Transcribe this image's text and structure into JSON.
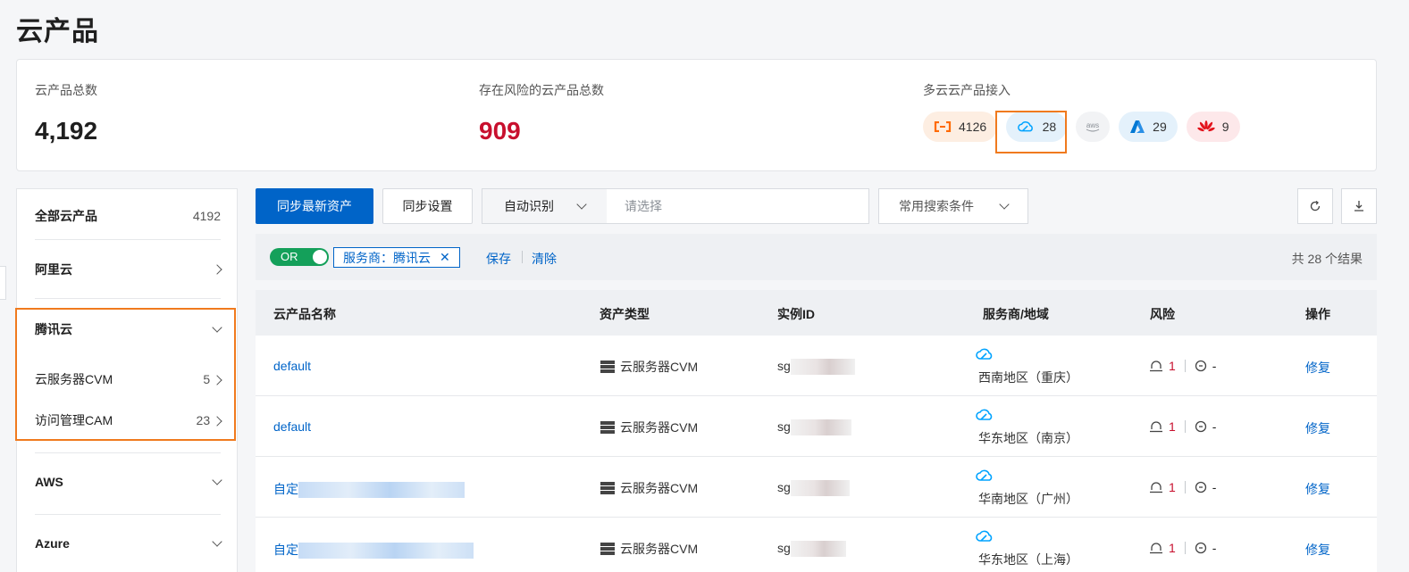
{
  "page_title": "云产品",
  "summary": {
    "total_label": "云产品总数",
    "total_value": "4,192",
    "risk_label": "存在风险的云产品总数",
    "risk_value": "909",
    "multicloud_label": "多云云产品接入",
    "providers": [
      {
        "icon": "aliyun-icon",
        "count": "4126",
        "color": "#ff6a00"
      },
      {
        "icon": "tencent-cloud-icon",
        "count": "28",
        "color": "#00a3ff"
      },
      {
        "icon": "aws-icon",
        "count": "",
        "label": "aws",
        "color": "#8a8f96"
      },
      {
        "icon": "azure-icon",
        "count": "29",
        "color": "#0078d4"
      },
      {
        "icon": "huawei-icon",
        "count": "9",
        "color": "#e3131c"
      }
    ]
  },
  "sidebar": {
    "all": {
      "label": "全部云产品",
      "count": "4192"
    },
    "groups": [
      {
        "label": "阿里云"
      },
      {
        "label": "腾讯云",
        "children": [
          {
            "label": "云服务器CVM",
            "count": "5"
          },
          {
            "label": "访问管理CAM",
            "count": "23"
          }
        ]
      },
      {
        "label": "AWS"
      },
      {
        "label": "Azure"
      }
    ]
  },
  "toolbar": {
    "sync_button": "同步最新资产",
    "sync_settings": "同步设置",
    "search_type": "自动识别",
    "search_placeholder": "请选择",
    "common_conditions": "常用搜索条件"
  },
  "filter": {
    "toggle_label": "OR",
    "chip_label": "服务商：腾讯云",
    "save": "保存",
    "clear": "清除",
    "result_count": "共 28 个结果"
  },
  "table": {
    "columns": [
      "云产品名称",
      "资产类型",
      "实例ID",
      "服务商/地域",
      "风险",
      "操作"
    ],
    "rows": [
      {
        "name": "default",
        "type": "云服务器CVM",
        "id_prefix": "sg",
        "region": "西南地区（重庆）",
        "risk": "1",
        "other": "-",
        "action": "修复"
      },
      {
        "name": "default",
        "type": "云服务器CVM",
        "id_prefix": "sg",
        "region": "华东地区（南京）",
        "risk": "1",
        "other": "-",
        "action": "修复"
      },
      {
        "name": "自定",
        "type": "云服务器CVM",
        "id_prefix": "sg",
        "region": "华南地区（广州）",
        "risk": "1",
        "other": "-",
        "action": "修复"
      },
      {
        "name": "自定",
        "type": "云服务器CVM",
        "id_prefix": "sg",
        "region": "华东地区（上海）",
        "risk": "1",
        "other": "-",
        "action": "修复"
      }
    ]
  }
}
